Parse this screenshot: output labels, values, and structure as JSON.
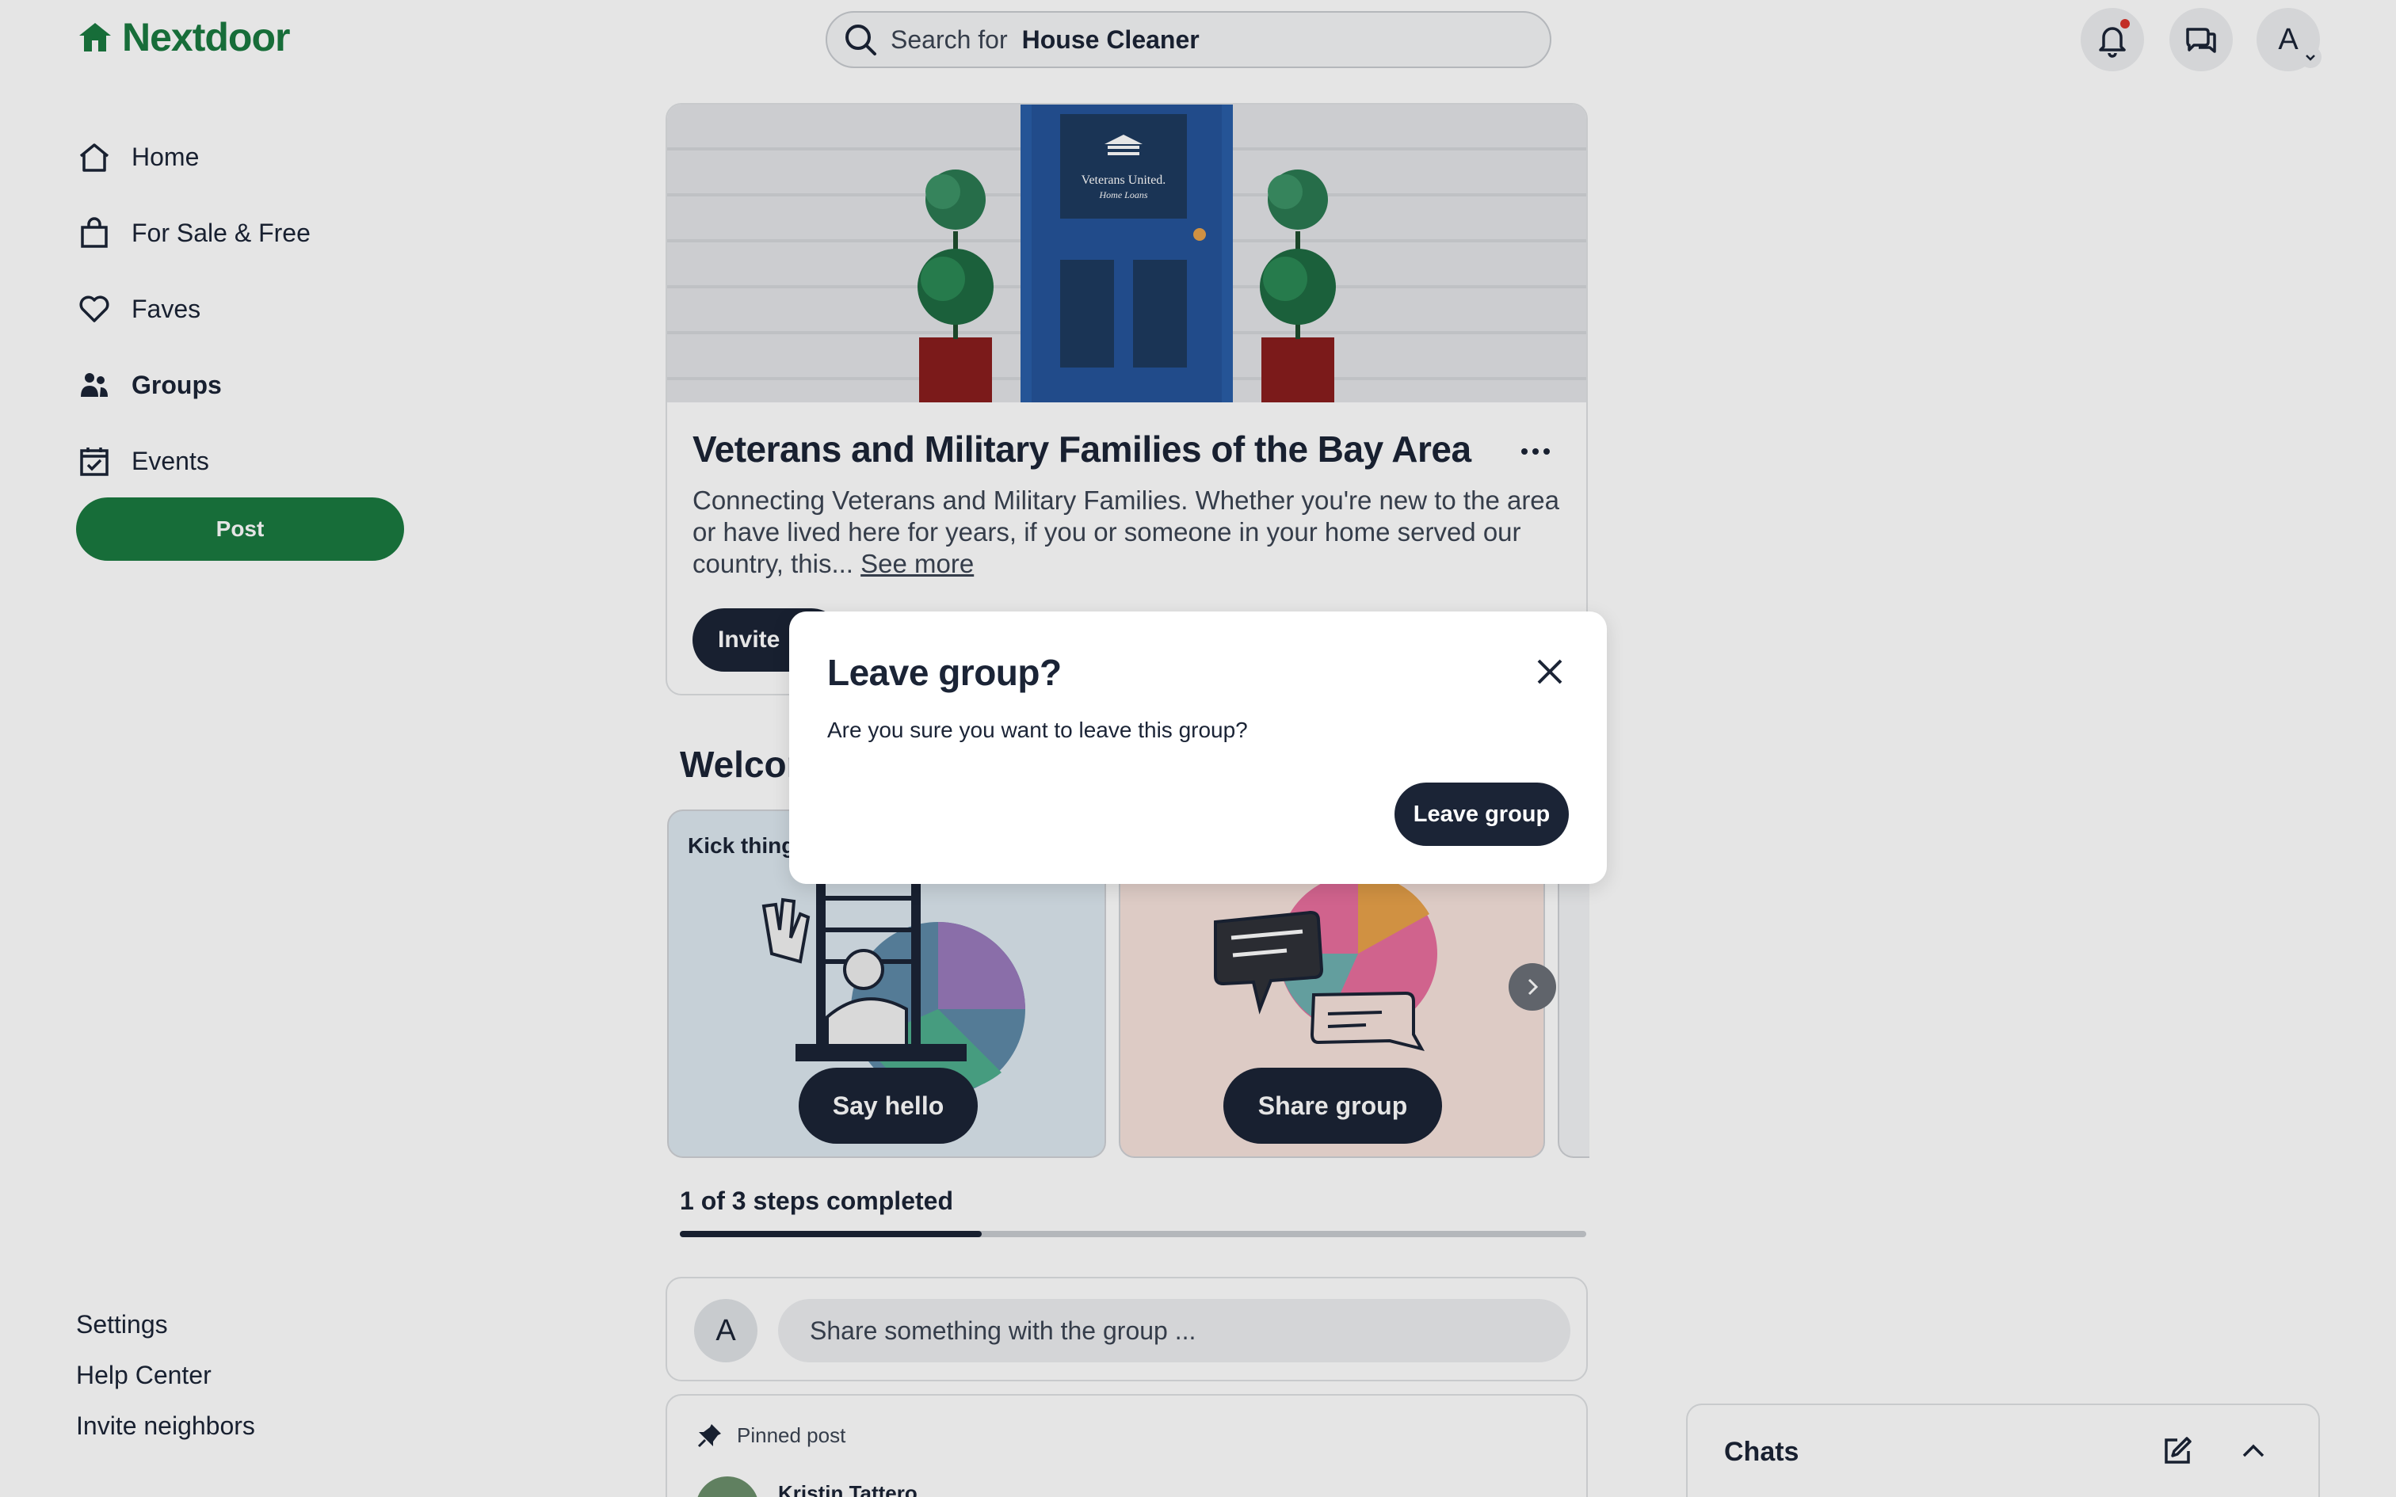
{
  "app": {
    "name": "Nextdoor"
  },
  "colors": {
    "brand": "#1a7a40",
    "dark": "#1b2436",
    "notification": "#d9342b"
  },
  "header": {
    "search_prefix": "Search for",
    "search_term": "House Cleaner",
    "avatar_initial": "A",
    "icons": [
      "search-icon",
      "bell-icon",
      "chat-bubbles-icon",
      "chevron-down-icon"
    ]
  },
  "nav": {
    "items": [
      {
        "label": "Home",
        "icon": "home-icon"
      },
      {
        "label": "For Sale & Free",
        "icon": "shopping-bag-icon"
      },
      {
        "label": "Faves",
        "icon": "heart-icon"
      },
      {
        "label": "Groups",
        "icon": "people-icon",
        "active": true
      },
      {
        "label": "Events",
        "icon": "calendar-icon"
      }
    ],
    "post_label": "Post",
    "footer_links": [
      "Settings",
      "Help Center",
      "Invite neighbors"
    ]
  },
  "group": {
    "title": "Veterans and Military Families of the Bay Area",
    "description": "Connecting Veterans and Military Families. Whether you're new to the area or have lived here for years, if you or someone in your home served our country, this...",
    "see_more": "See more",
    "invite_label": "Invite",
    "door_sign_line1": "Veterans United.",
    "door_sign_line2": "Home Loans"
  },
  "welcome": {
    "heading": "Welcome",
    "cards": [
      {
        "kicker": "Kick things off",
        "button": "Say hello"
      },
      {
        "button": "Share group"
      }
    ],
    "steps_text": "1 of 3 steps completed",
    "steps_completed": 1,
    "steps_total": 3
  },
  "composer": {
    "avatar_initial": "A",
    "placeholder": "Share something with the group ..."
  },
  "pinned": {
    "label": "Pinned post",
    "author": "Kristin Tattero"
  },
  "chats": {
    "title": "Chats"
  },
  "modal": {
    "title": "Leave group?",
    "body": "Are you sure you want to leave this group?",
    "confirm_label": "Leave group"
  }
}
